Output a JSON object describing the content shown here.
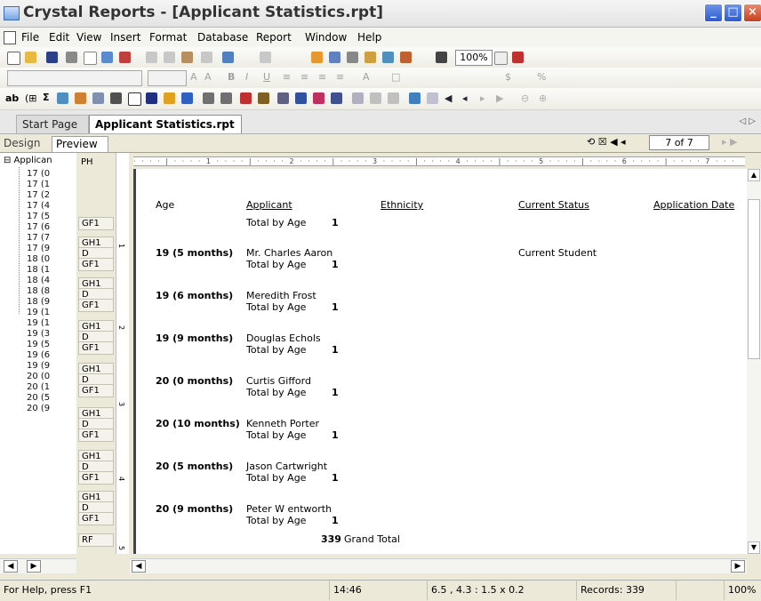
{
  "window": {
    "title": "Crystal Reports - [Applicant Statistics.rpt]"
  },
  "menu": [
    "File",
    "Edit",
    "View",
    "Insert",
    "Format",
    "Database",
    "Report",
    "Window",
    "Help"
  ],
  "toolbar": {
    "zoom": "100%"
  },
  "tabs": {
    "start_page": "Start Page",
    "doc_tab": "Applicant Statistics.rpt  ×"
  },
  "view_tabs": {
    "design": "Design",
    "preview": "Preview ×",
    "page_indicator": "7 of 7"
  },
  "group_tree": {
    "root": "⊟ Applican",
    "items": [
      "17 (0",
      "17 (1",
      "17 (2",
      "17 (4",
      "17 (5",
      "17 (6",
      "17 (7",
      "17 (9",
      "18 (0",
      "18 (1",
      "18 (4",
      "18 (8",
      "18 (9",
      "19 (1",
      "19 (1",
      "19 (3",
      "19 (5",
      "19 (6",
      "19 (9",
      "20 (0",
      "20 (1",
      "20 (5",
      "20 (9"
    ]
  },
  "sections": [
    "PH",
    "GF1",
    "GH1",
    "D",
    "GF1",
    "GH1",
    "D",
    "GF1",
    "GH1",
    "D",
    "GF1",
    "GH1",
    "D",
    "GF1",
    "GH1",
    "D",
    "GF1",
    "GH1",
    "D",
    "GF1",
    "GH1",
    "D",
    "GF1",
    "RF"
  ],
  "ruler": {
    "marks": "· · · · | · · · · 1 · · · · | · · · · 2 · · · · | · · · · 3 · · · · | · · · · 4 · · · · | · · · · 5 · · · · | · · · · 6 · · · · | · · · · 7 · · ·",
    "vnums": [
      "1",
      "2",
      "3",
      "4",
      "5"
    ]
  },
  "report": {
    "headers": {
      "age": "Age",
      "applicant": "Applicant",
      "ethnicity": "Ethnicity",
      "status": "Current Status",
      "date": "Application Date"
    },
    "top_total": {
      "label": "Total by Age",
      "count": "1"
    },
    "groups": [
      {
        "age": "19 (5 months)",
        "name": "Mr. Charles Aaron",
        "status": "Current Student",
        "total_label": "Total by Age",
        "count": "1"
      },
      {
        "age": "19 (6 months)",
        "name": "Meredith Frost",
        "status": "",
        "total_label": "Total by Age",
        "count": "1"
      },
      {
        "age": "19 (9 months)",
        "name": "Douglas Echols",
        "status": "",
        "total_label": "Total by Age",
        "count": "1"
      },
      {
        "age": "20 (0 months)",
        "name": "Curtis Gifford",
        "status": "",
        "total_label": "Total by Age",
        "count": "1"
      },
      {
        "age": "20 (10 months)",
        "name": "Kenneth Porter",
        "status": "",
        "total_label": "Total by Age",
        "count": "1"
      },
      {
        "age": "20 (5 months)",
        "name": "Jason Cartwright",
        "status": "",
        "total_label": "Total by Age",
        "count": "1"
      },
      {
        "age": "20 (9 months)",
        "name": "Peter W entworth",
        "status": "",
        "total_label": "Total by Age",
        "count": "1"
      }
    ],
    "grand_total": {
      "count": "339",
      "label": "Grand Total"
    }
  },
  "status_bar": {
    "help": "For Help, press F1",
    "time": "14:46",
    "position": "6.5 , 4.3 : 1.5 x 0.2",
    "records": "Records: 339",
    "zoom": "100%"
  }
}
